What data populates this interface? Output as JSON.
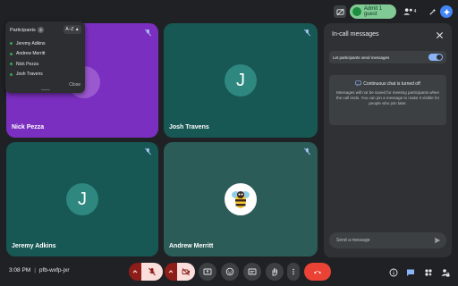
{
  "topbar": {
    "admit_label": "Admit 1 guest",
    "participant_count": "4"
  },
  "participants_popup": {
    "title": "Participants",
    "count": "4",
    "sort_label": "A–Z ▲",
    "people": [
      "Jeremy Adkins",
      "Andrew Merritt",
      "Nick Pezza",
      "Josh Travens"
    ],
    "close_label": "Close"
  },
  "tiles": {
    "nick": {
      "name": "Nick Pezza",
      "bg": "#7b2fc0"
    },
    "josh": {
      "name": "Josh Travens",
      "initial": "J",
      "bg": "#175754"
    },
    "jeremy": {
      "name": "Jeremy Adkins",
      "initial": "J",
      "bg": "#175754"
    },
    "andrew": {
      "name": "Andrew Merritt",
      "bg": "#2b5c58"
    }
  },
  "panel": {
    "title": "In-call messages",
    "toggle_label": "Let participants send messages",
    "toggle_on": true,
    "info_heading": "Continuous chat is turned off",
    "info_body": "Messages will not be saved for meeting participants when the call ends. You can pin a message to make it visible for people who join later.",
    "send_placeholder": "Send a message"
  },
  "bottombar": {
    "time": "3:08 PM",
    "meeting_code": "pfb-wxfp-jxr"
  },
  "colors": {
    "accent": "#8ab4f8",
    "danger": "#ea4335",
    "muted_btn": "#f9dedc",
    "dark_red": "#8c1d18",
    "green": "#81c995"
  }
}
